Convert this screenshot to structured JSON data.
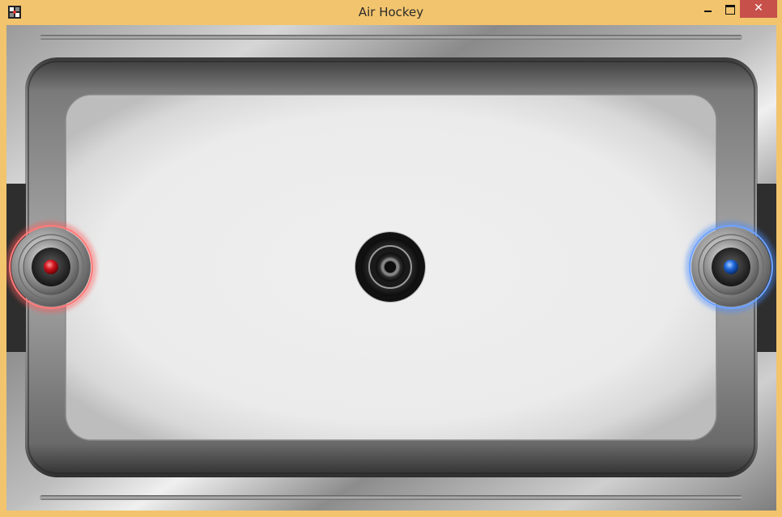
{
  "window": {
    "title": "Air Hockey",
    "icon": "air-hockey-app-icon",
    "controls": {
      "minimize_icon": "minimize-icon",
      "maximize_icon": "maximize-icon",
      "close_icon": "close-icon",
      "close_glyph": "✕"
    },
    "frame_color": "#f2c46d",
    "close_color": "#c7504a"
  },
  "game": {
    "table_color": "#ececec",
    "rail_color": "#8f8f8f",
    "goals": [
      {
        "side": "left"
      },
      {
        "side": "right"
      }
    ],
    "paddles": [
      {
        "player": "red",
        "side": "left",
        "glow_color": "#ff5a5a",
        "knob_color": "#d0141c"
      },
      {
        "player": "blue",
        "side": "right",
        "glow_color": "#4a8cff",
        "knob_color": "#1d66d8"
      }
    ],
    "puck": {
      "color": "#151515"
    }
  }
}
